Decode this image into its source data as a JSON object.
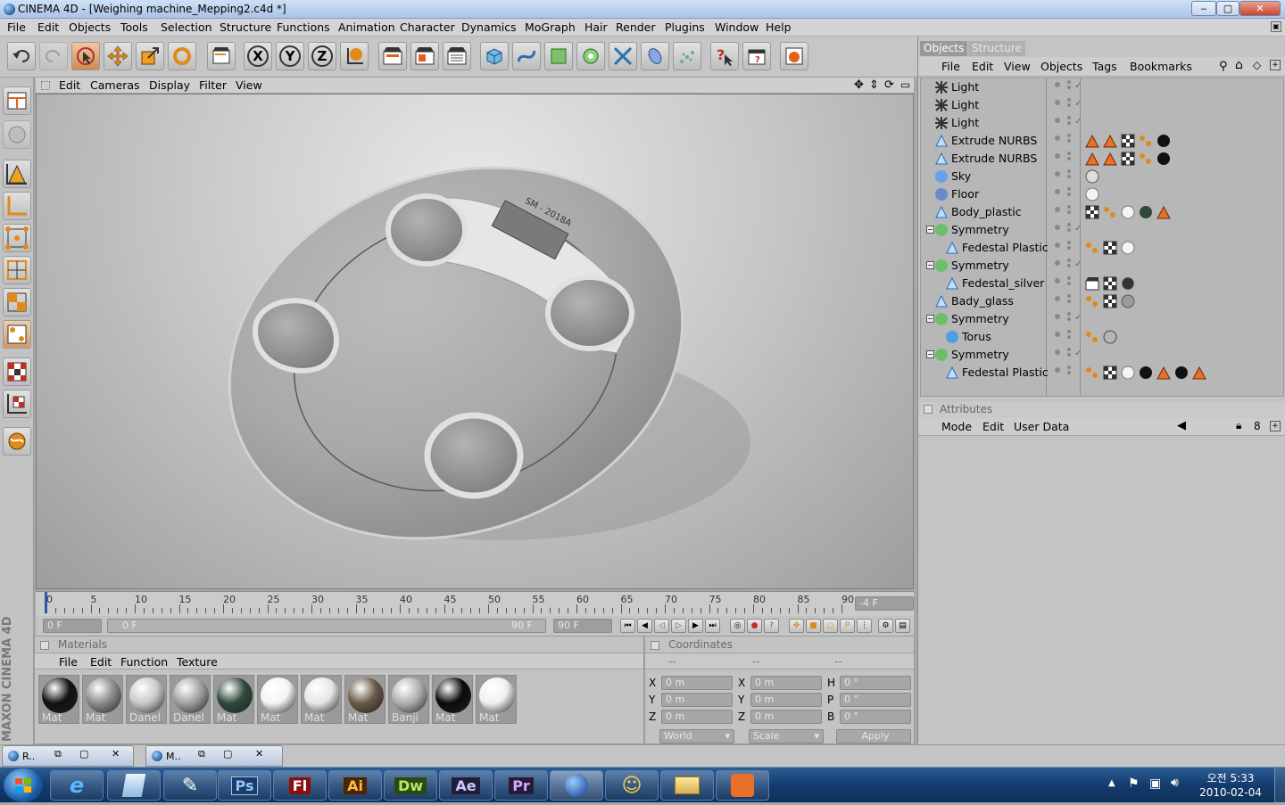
{
  "window": {
    "title": "CINEMA 4D - [Weighing machine_Mepping2.c4d *]",
    "min": "‒",
    "max": "▢",
    "close": "✕"
  },
  "menubar": [
    "File",
    "Edit",
    "Objects",
    "Tools",
    "Selection",
    "Structure",
    "Functions",
    "Animation",
    "Character",
    "Dynamics",
    "MoGraph",
    "Hair",
    "Render",
    "Plugins",
    "Window",
    "Help"
  ],
  "viewport_menu": [
    "Edit",
    "Cameras",
    "Display",
    "Filter",
    "View"
  ],
  "toolbar_axis": {
    "x": "X",
    "y": "Y",
    "z": "Z"
  },
  "object_manager": {
    "tabs": [
      "Objects",
      "Structure"
    ],
    "menu": [
      "File",
      "Edit",
      "View",
      "Objects",
      "Tags",
      "Bookmarks"
    ],
    "objects": [
      {
        "name": "Light",
        "indent": 0,
        "icon": "light-icon"
      },
      {
        "name": "Light",
        "indent": 0,
        "icon": "light-icon"
      },
      {
        "name": "Light",
        "indent": 0,
        "icon": "light-icon"
      },
      {
        "name": "Extrude NURBS",
        "indent": 0,
        "icon": "nurbs-icon"
      },
      {
        "name": "Extrude NURBS",
        "indent": 0,
        "icon": "nurbs-icon"
      },
      {
        "name": "Sky",
        "indent": 0,
        "icon": "sky-icon"
      },
      {
        "name": "Floor",
        "indent": 0,
        "icon": "floor-icon"
      },
      {
        "name": "Body_plastic",
        "indent": 0,
        "icon": "polygon-icon"
      },
      {
        "name": "Symmetry",
        "indent": 0,
        "icon": "symmetry-icon"
      },
      {
        "name": "Fedestal Plastic",
        "indent": 1,
        "icon": "polygon-icon"
      },
      {
        "name": "Symmetry",
        "indent": 0,
        "icon": "symmetry-icon"
      },
      {
        "name": "Fedestal_silver",
        "indent": 1,
        "icon": "polygon-icon"
      },
      {
        "name": "Bady_glass",
        "indent": 0,
        "icon": "polygon-icon"
      },
      {
        "name": "Symmetry",
        "indent": 0,
        "icon": "symmetry-icon"
      },
      {
        "name": "Torus",
        "indent": 1,
        "icon": "torus-icon"
      },
      {
        "name": "Symmetry",
        "indent": 0,
        "icon": "symmetry-icon"
      },
      {
        "name": "Fedestal Plastic",
        "indent": 1,
        "icon": "polygon-icon"
      }
    ]
  },
  "attributes": {
    "title": "Attributes",
    "menu": [
      "Mode",
      "Edit",
      "User Data"
    ]
  },
  "timeline": {
    "ticks": [
      "0",
      "5",
      "10",
      "15",
      "20",
      "25",
      "30",
      "35",
      "40",
      "45",
      "50",
      "55",
      "60",
      "65",
      "70",
      "75",
      "80",
      "85",
      "90"
    ],
    "current": "-4 F",
    "start": "0 F",
    "slider_start": "0 F",
    "slider_end": "90 F",
    "end": "90 F"
  },
  "materials": {
    "title": "Materials",
    "menu": [
      "File",
      "Edit",
      "Function",
      "Texture"
    ],
    "items": [
      {
        "name": "Mat",
        "color": "#111111"
      },
      {
        "name": "Mat",
        "color": "#8c8c8c"
      },
      {
        "name": "Danel",
        "color": "#c8c8c8"
      },
      {
        "name": "Danel",
        "color": "#a0a0a0"
      },
      {
        "name": "Mat",
        "color": "#2f4a3a"
      },
      {
        "name": "Mat",
        "color": "#f4f4f4"
      },
      {
        "name": "Mat",
        "color": "#e6e6e6"
      },
      {
        "name": "Mat",
        "color": "#6a5a48"
      },
      {
        "name": "Banji",
        "color": "#b0b0b0"
      },
      {
        "name": "Mat",
        "color": "#0a0a0a"
      },
      {
        "name": "Mat",
        "color": "#f0f0f0"
      }
    ]
  },
  "coordinates": {
    "title": "Coordinates",
    "headers": [
      "--",
      "--",
      "--"
    ],
    "rows": [
      {
        "a": "X",
        "av": "0 m",
        "b": "X",
        "bv": "0 m",
        "c": "H",
        "cv": "0 °"
      },
      {
        "a": "Y",
        "av": "0 m",
        "b": "Y",
        "bv": "0 m",
        "c": "P",
        "cv": "0 °"
      },
      {
        "a": "Z",
        "av": "0 m",
        "b": "Z",
        "bv": "0 m",
        "c": "B",
        "cv": "0 °"
      }
    ],
    "world": "World",
    "scale": "Scale",
    "apply": "Apply"
  },
  "scale_display": "SM - 2018A",
  "bottom_windows": [
    "R..",
    "M.."
  ],
  "logo_text": "MAXON CINEMA 4D",
  "taskbar": {
    "apps": [
      "Ps",
      "Fl",
      "Ai",
      "Dw",
      "Ae",
      "Pr"
    ],
    "clock_time": "오전 5:33",
    "clock_date": "2010-02-04"
  }
}
